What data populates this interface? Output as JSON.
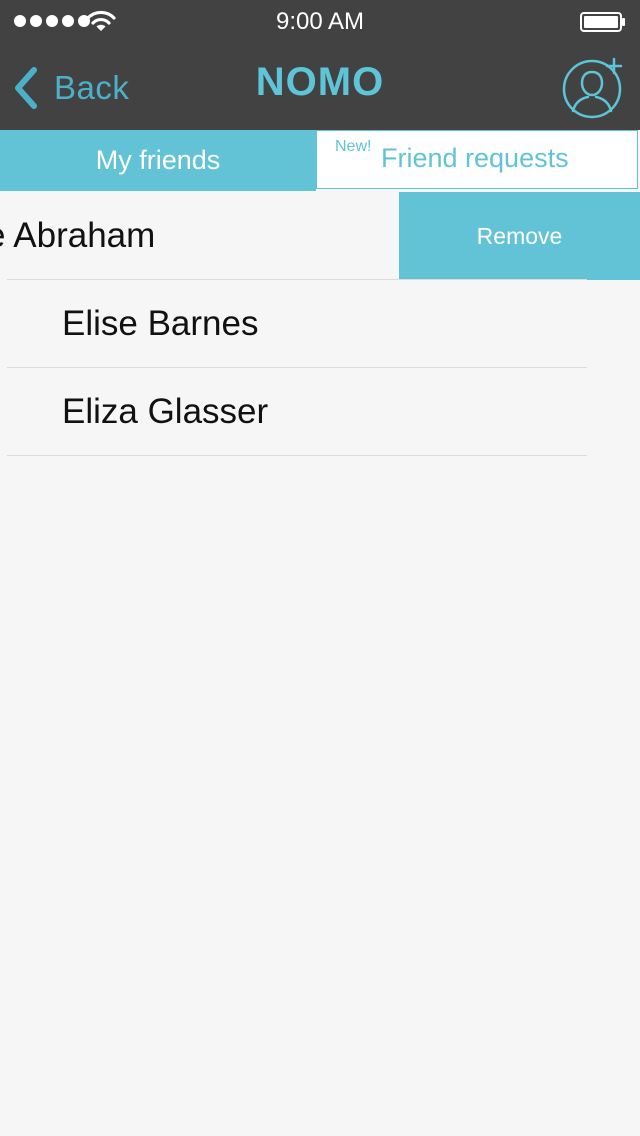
{
  "status_bar": {
    "time": "9:00 AM",
    "signal_strength": 5,
    "signal_icon": "signal-dots-icon",
    "wifi_icon": "wifi-icon",
    "battery_icon": "battery-icon",
    "battery_level": 1.0
  },
  "nav": {
    "back_label": "Back",
    "back_icon": "chevron-left-icon",
    "title": "NOMO",
    "add_friend_icon": "add-user-icon"
  },
  "tabs": {
    "my_friends_label": "My friends",
    "requests_badge": "New!",
    "requests_label": "Friend requests",
    "active_tab": "my_friends"
  },
  "friends": [
    {
      "name": "e Abraham",
      "action_label": "Remove"
    },
    {
      "name": "Elise Barnes"
    },
    {
      "name": "Eliza Glasser"
    }
  ],
  "colors": {
    "accent": "#62c3d7",
    "topbar": "#424242",
    "background": "#f6f6f6"
  }
}
